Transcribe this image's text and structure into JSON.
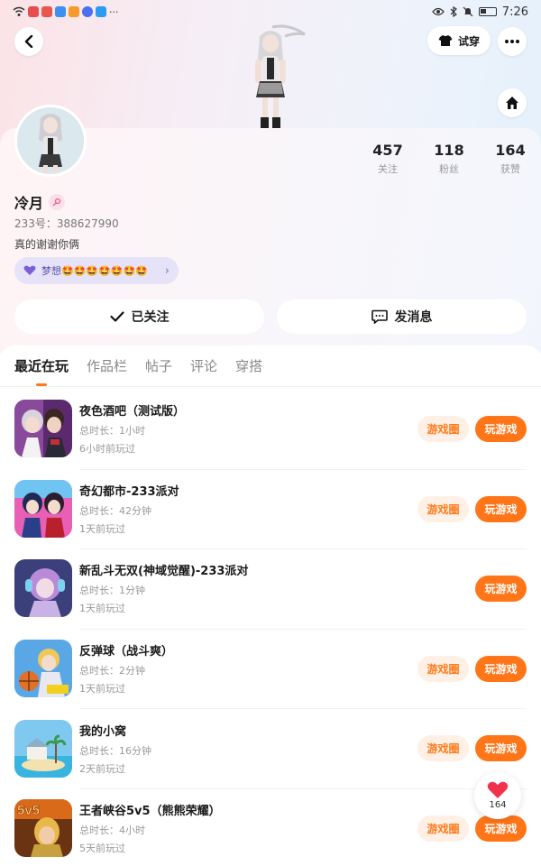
{
  "status_bar": {
    "time": "7:26",
    "dots": "···"
  },
  "header": {
    "try_on_label": "试穿"
  },
  "profile": {
    "name": "冷月",
    "uid": "233号：388627990",
    "bio": "真的谢谢你俩",
    "dream_text": "梦想🤩🤩🤩🤩🤩🤩🤩",
    "stats": [
      {
        "value": "457",
        "label": "关注"
      },
      {
        "value": "118",
        "label": "粉丝"
      },
      {
        "value": "164",
        "label": "获赞"
      }
    ]
  },
  "actions": {
    "followed_label": "已关注",
    "message_label": "发消息"
  },
  "tabs": [
    {
      "label": "最近在玩",
      "active": true
    },
    {
      "label": "作品栏",
      "active": false
    },
    {
      "label": "帖子",
      "active": false
    },
    {
      "label": "评论",
      "active": false
    },
    {
      "label": "穿搭",
      "active": false
    }
  ],
  "games": [
    {
      "title": "夜色酒吧（测试版）",
      "duration": "总时长：1小时",
      "last_played": "6小时前玩过",
      "circle_label": "游戏圈",
      "play_label": "玩游戏",
      "has_circle": true
    },
    {
      "title": "奇幻都市-233派对",
      "duration": "总时长：42分钟",
      "last_played": "1天前玩过",
      "circle_label": "游戏圈",
      "play_label": "玩游戏",
      "has_circle": true
    },
    {
      "title": "新乱斗无双(神域觉醒)-233派对",
      "duration": "总时长：1分钟",
      "last_played": "1天前玩过",
      "circle_label": "",
      "play_label": "玩游戏",
      "has_circle": false
    },
    {
      "title": "反弹球（战斗爽）",
      "duration": "总时长：2分钟",
      "last_played": "1天前玩过",
      "circle_label": "游戏圈",
      "play_label": "玩游戏",
      "has_circle": true
    },
    {
      "title": "我的小窝",
      "duration": "总时长：16分钟",
      "last_played": "2天前玩过",
      "circle_label": "游戏圈",
      "play_label": "玩游戏",
      "has_circle": true
    },
    {
      "title": "王者峡谷5v5（熊熊荣耀）",
      "duration": "总时长：4小时",
      "last_played": "5天前玩过",
      "circle_label": "游戏圈",
      "play_label": "玩游戏",
      "has_circle": true
    }
  ],
  "like_float": {
    "count": "164"
  },
  "colors": {
    "accent": "#ff7518",
    "accent_light": "#fff0e6",
    "dream_bg": "#e6e3f8"
  }
}
